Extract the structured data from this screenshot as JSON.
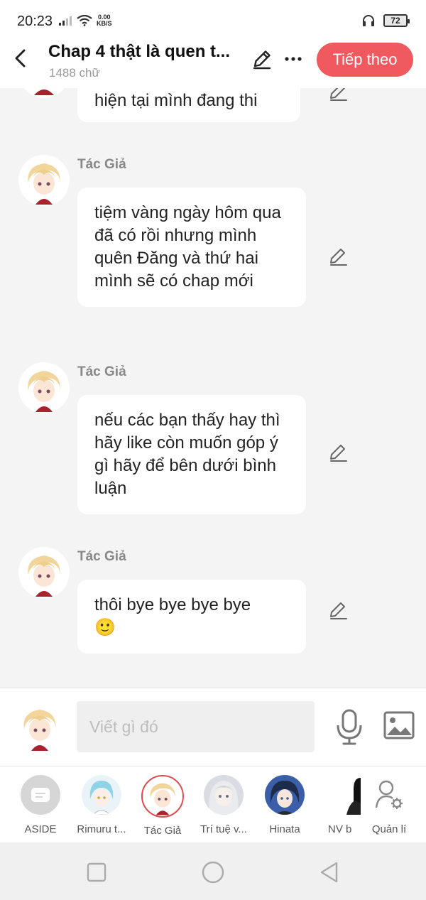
{
  "status_bar": {
    "time": "20:23",
    "net_speed_value": "0.00",
    "net_speed_unit": "KB/S",
    "battery": "72"
  },
  "header": {
    "title": "Chap 4 thật là quen t...",
    "word_count": "1488 chữ",
    "next_label": "Tiếp theo"
  },
  "messages": [
    {
      "author": "",
      "text": "hiện tại mình đang thi"
    },
    {
      "author": "Tác Giả",
      "text": "tiệm vàng ngày hôm qua đã có rồi nhưng mình quên Đăng và thứ hai mình sẽ có chap mới"
    },
    {
      "author": "Tác Giả",
      "text": "nếu các bạn thấy hay thì hãy like còn muốn góp ý gì hãy để bên dưới bình luận"
    },
    {
      "author": "Tác Giả",
      "text": "thôi bye bye bye bye",
      "emoji": "🙂"
    }
  ],
  "composer": {
    "placeholder": "Viết gì đó"
  },
  "characters": [
    {
      "label": "ASIDE"
    },
    {
      "label": "Rimuru t..."
    },
    {
      "label": "Tác Giả"
    },
    {
      "label": "Trí tuệ v..."
    },
    {
      "label": "Hinata"
    },
    {
      "label": "NV b"
    },
    {
      "label": "Quản lí"
    }
  ],
  "colors": {
    "accent": "#f05a5e",
    "background": "#f4f4f4",
    "bubble": "#ffffff"
  },
  "icons": {
    "back": "back-arrow-icon",
    "edit": "pencil-icon",
    "more": "more-dots-icon",
    "mic": "microphone-icon",
    "image": "image-icon",
    "manage": "user-gear-icon"
  }
}
